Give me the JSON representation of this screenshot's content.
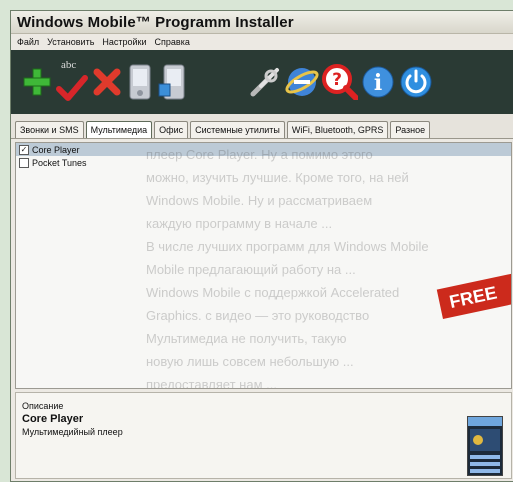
{
  "window": {
    "title": "Windows Mobile™ Programm Installer"
  },
  "menu": {
    "items": [
      "Файл",
      "Установить",
      "Настройки",
      "Справка"
    ]
  },
  "toolbar": {
    "icons": [
      "add-icon",
      "spellcheck-icon",
      "check-icon",
      "delete-icon",
      "device-icon",
      "device-install-icon",
      "tools-icon",
      "internet-explorer-icon",
      "help-icon",
      "info-icon",
      "power-icon"
    ],
    "abc_label": "abc"
  },
  "tabs": [
    {
      "label": "Звонки и SMS",
      "active": false
    },
    {
      "label": "Мультимедиа",
      "active": true
    },
    {
      "label": "Офис",
      "active": false
    },
    {
      "label": "Системные утилиты",
      "active": false
    },
    {
      "label": "WiFi, Bluetooth, GPRS",
      "active": false
    },
    {
      "label": "Разное",
      "active": false
    }
  ],
  "programs": [
    {
      "label": "Core Player",
      "checked": true,
      "selected": true
    },
    {
      "label": "Pocket Tunes",
      "checked": false,
      "selected": false
    }
  ],
  "background_text": [
    "плеер Core Player. Ну а помимо этого",
    "можно, изучить лучшие. Кроме того, на ней",
    "Windows Mobile. Ну и рассматриваем",
    "каждую программу в начале ...",
    "В числе лучших программ для Windows Mobile",
    "Mobile предлагающий работу на ...",
    "Windows Mobile с поддержкой Accelerated",
    "Graphics. с видео — это руководство",
    "Мультимедиа не получить, такую",
    "новую лишь совсем небольшую ...",
    "предоставляет нам ..."
  ],
  "banner": {
    "label": "FREE"
  },
  "description": {
    "heading": "Описание",
    "name": "Core Player",
    "text": "Мультимедийный плеер"
  },
  "colors": {
    "toolbar_bg": "#2a3a34",
    "selected_row": "#bccad6",
    "banner": "#cc2a1c"
  }
}
